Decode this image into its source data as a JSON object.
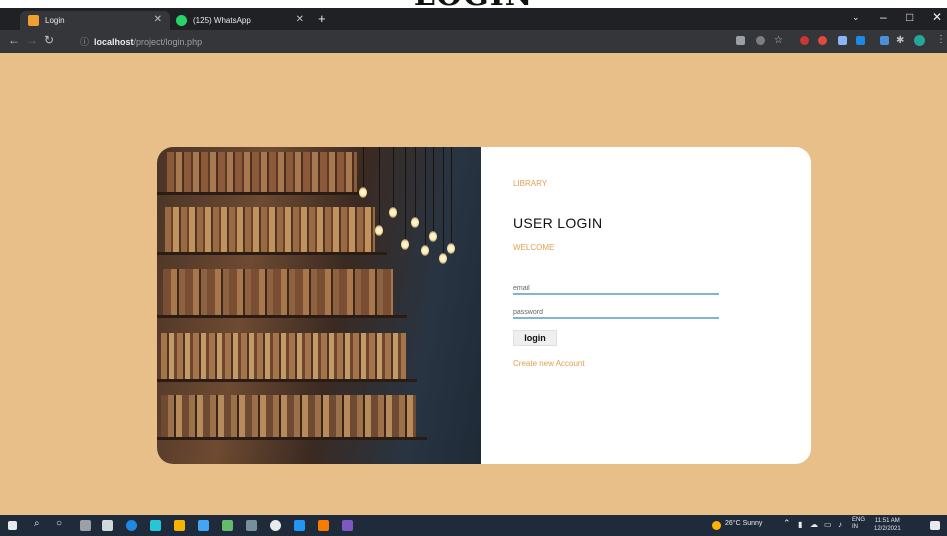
{
  "page_heading": "LOGIN",
  "browser": {
    "tabs": [
      {
        "title": "Login",
        "active": true,
        "favicon_color": "#f0a030"
      },
      {
        "title": "(125) WhatsApp",
        "active": false,
        "favicon_color": "#25d366"
      }
    ],
    "url_host": "localhost",
    "url_path": "/project/login.php",
    "window_controls": {
      "minimize": "–",
      "maximize": "□",
      "close": "✕"
    }
  },
  "login_card": {
    "brand": "LIBRARY",
    "title": "USER LOGIN",
    "subtitle": "WELCOME",
    "email_placeholder": "email",
    "password_placeholder": "password",
    "login_button": "login",
    "create_account_link": "Create new Account"
  },
  "taskbar": {
    "weather": "26°C Sunny",
    "language": "ENG\nIN",
    "time": "11:51 AM",
    "date": "12/2/2021"
  },
  "colors": {
    "page_background": "#e8bf88",
    "accent": "#e0a050",
    "input_underline": "#7fb6d6"
  }
}
